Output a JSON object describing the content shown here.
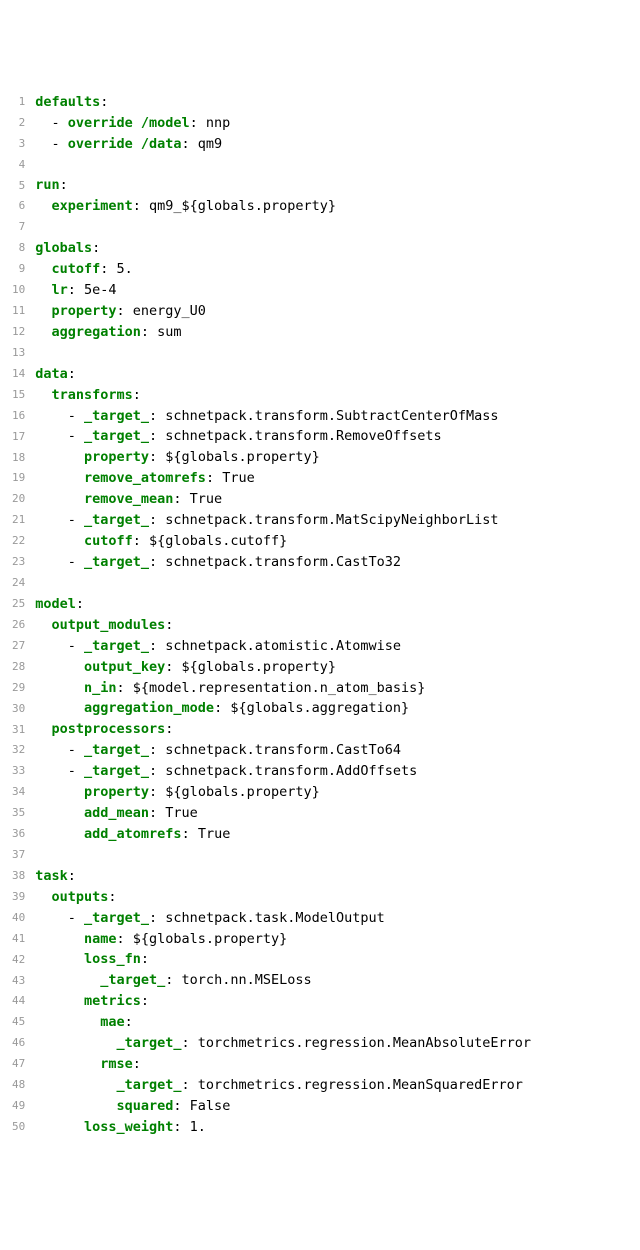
{
  "lines": [
    {
      "n": "1",
      "segs": [
        {
          "c": "k",
          "t": "defaults"
        },
        {
          "c": "t",
          "t": ":"
        }
      ]
    },
    {
      "n": "2",
      "segs": [
        {
          "c": "t",
          "t": "  - "
        },
        {
          "c": "k",
          "t": "override /model"
        },
        {
          "c": "t",
          "t": ": nnp"
        }
      ]
    },
    {
      "n": "3",
      "segs": [
        {
          "c": "t",
          "t": "  - "
        },
        {
          "c": "k",
          "t": "override /data"
        },
        {
          "c": "t",
          "t": ": qm9"
        }
      ]
    },
    {
      "n": "4",
      "segs": [
        {
          "c": "t",
          "t": ""
        }
      ]
    },
    {
      "n": "5",
      "segs": [
        {
          "c": "k",
          "t": "run"
        },
        {
          "c": "t",
          "t": ":"
        }
      ]
    },
    {
      "n": "6",
      "segs": [
        {
          "c": "t",
          "t": "  "
        },
        {
          "c": "k",
          "t": "experiment"
        },
        {
          "c": "t",
          "t": ": qm9_${globals.property}"
        }
      ]
    },
    {
      "n": "7",
      "segs": [
        {
          "c": "t",
          "t": ""
        }
      ]
    },
    {
      "n": "8",
      "segs": [
        {
          "c": "k",
          "t": "globals"
        },
        {
          "c": "t",
          "t": ":"
        }
      ]
    },
    {
      "n": "9",
      "segs": [
        {
          "c": "t",
          "t": "  "
        },
        {
          "c": "k",
          "t": "cutoff"
        },
        {
          "c": "t",
          "t": ": 5."
        }
      ]
    },
    {
      "n": "10",
      "segs": [
        {
          "c": "t",
          "t": "  "
        },
        {
          "c": "k",
          "t": "lr"
        },
        {
          "c": "t",
          "t": ": 5e-4"
        }
      ]
    },
    {
      "n": "11",
      "segs": [
        {
          "c": "t",
          "t": "  "
        },
        {
          "c": "k",
          "t": "property"
        },
        {
          "c": "t",
          "t": ": energy_U0"
        }
      ]
    },
    {
      "n": "12",
      "segs": [
        {
          "c": "t",
          "t": "  "
        },
        {
          "c": "k",
          "t": "aggregation"
        },
        {
          "c": "t",
          "t": ": sum"
        }
      ]
    },
    {
      "n": "13",
      "segs": [
        {
          "c": "t",
          "t": ""
        }
      ]
    },
    {
      "n": "14",
      "segs": [
        {
          "c": "k",
          "t": "data"
        },
        {
          "c": "t",
          "t": ":"
        }
      ]
    },
    {
      "n": "15",
      "segs": [
        {
          "c": "t",
          "t": "  "
        },
        {
          "c": "k",
          "t": "transforms"
        },
        {
          "c": "t",
          "t": ":"
        }
      ]
    },
    {
      "n": "16",
      "segs": [
        {
          "c": "t",
          "t": "    - "
        },
        {
          "c": "k",
          "t": "_target_"
        },
        {
          "c": "t",
          "t": ": schnetpack.transform.SubtractCenterOfMass"
        }
      ]
    },
    {
      "n": "17",
      "segs": [
        {
          "c": "t",
          "t": "    - "
        },
        {
          "c": "k",
          "t": "_target_"
        },
        {
          "c": "t",
          "t": ": schnetpack.transform.RemoveOffsets"
        }
      ]
    },
    {
      "n": "18",
      "segs": [
        {
          "c": "t",
          "t": "      "
        },
        {
          "c": "k",
          "t": "property"
        },
        {
          "c": "t",
          "t": ": ${globals.property}"
        }
      ]
    },
    {
      "n": "19",
      "segs": [
        {
          "c": "t",
          "t": "      "
        },
        {
          "c": "k",
          "t": "remove_atomrefs"
        },
        {
          "c": "t",
          "t": ": True"
        }
      ]
    },
    {
      "n": "20",
      "segs": [
        {
          "c": "t",
          "t": "      "
        },
        {
          "c": "k",
          "t": "remove_mean"
        },
        {
          "c": "t",
          "t": ": True"
        }
      ]
    },
    {
      "n": "21",
      "segs": [
        {
          "c": "t",
          "t": "    - "
        },
        {
          "c": "k",
          "t": "_target_"
        },
        {
          "c": "t",
          "t": ": schnetpack.transform.MatScipyNeighborList"
        }
      ]
    },
    {
      "n": "22",
      "segs": [
        {
          "c": "t",
          "t": "      "
        },
        {
          "c": "k",
          "t": "cutoff"
        },
        {
          "c": "t",
          "t": ": ${globals.cutoff}"
        }
      ]
    },
    {
      "n": "23",
      "segs": [
        {
          "c": "t",
          "t": "    - "
        },
        {
          "c": "k",
          "t": "_target_"
        },
        {
          "c": "t",
          "t": ": schnetpack.transform.CastTo32"
        }
      ]
    },
    {
      "n": "24",
      "segs": [
        {
          "c": "t",
          "t": ""
        }
      ]
    },
    {
      "n": "25",
      "segs": [
        {
          "c": "k",
          "t": "model"
        },
        {
          "c": "t",
          "t": ":"
        }
      ]
    },
    {
      "n": "26",
      "segs": [
        {
          "c": "t",
          "t": "  "
        },
        {
          "c": "k",
          "t": "output_modules"
        },
        {
          "c": "t",
          "t": ":"
        }
      ]
    },
    {
      "n": "27",
      "segs": [
        {
          "c": "t",
          "t": "    - "
        },
        {
          "c": "k",
          "t": "_target_"
        },
        {
          "c": "t",
          "t": ": schnetpack.atomistic.Atomwise"
        }
      ]
    },
    {
      "n": "28",
      "segs": [
        {
          "c": "t",
          "t": "      "
        },
        {
          "c": "k",
          "t": "output_key"
        },
        {
          "c": "t",
          "t": ": ${globals.property}"
        }
      ]
    },
    {
      "n": "29",
      "segs": [
        {
          "c": "t",
          "t": "      "
        },
        {
          "c": "k",
          "t": "n_in"
        },
        {
          "c": "t",
          "t": ": ${model.representation.n_atom_basis}"
        }
      ]
    },
    {
      "n": "30",
      "segs": [
        {
          "c": "t",
          "t": "      "
        },
        {
          "c": "k",
          "t": "aggregation_mode"
        },
        {
          "c": "t",
          "t": ": ${globals.aggregation}"
        }
      ]
    },
    {
      "n": "31",
      "segs": [
        {
          "c": "t",
          "t": "  "
        },
        {
          "c": "k",
          "t": "postprocessors"
        },
        {
          "c": "t",
          "t": ":"
        }
      ]
    },
    {
      "n": "32",
      "segs": [
        {
          "c": "t",
          "t": "    - "
        },
        {
          "c": "k",
          "t": "_target_"
        },
        {
          "c": "t",
          "t": ": schnetpack.transform.CastTo64"
        }
      ]
    },
    {
      "n": "33",
      "segs": [
        {
          "c": "t",
          "t": "    - "
        },
        {
          "c": "k",
          "t": "_target_"
        },
        {
          "c": "t",
          "t": ": schnetpack.transform.AddOffsets"
        }
      ]
    },
    {
      "n": "34",
      "segs": [
        {
          "c": "t",
          "t": "      "
        },
        {
          "c": "k",
          "t": "property"
        },
        {
          "c": "t",
          "t": ": ${globals.property}"
        }
      ]
    },
    {
      "n": "35",
      "segs": [
        {
          "c": "t",
          "t": "      "
        },
        {
          "c": "k",
          "t": "add_mean"
        },
        {
          "c": "t",
          "t": ": True"
        }
      ]
    },
    {
      "n": "36",
      "segs": [
        {
          "c": "t",
          "t": "      "
        },
        {
          "c": "k",
          "t": "add_atomrefs"
        },
        {
          "c": "t",
          "t": ": True"
        }
      ]
    },
    {
      "n": "37",
      "segs": [
        {
          "c": "t",
          "t": ""
        }
      ]
    },
    {
      "n": "38",
      "segs": [
        {
          "c": "k",
          "t": "task"
        },
        {
          "c": "t",
          "t": ":"
        }
      ]
    },
    {
      "n": "39",
      "segs": [
        {
          "c": "t",
          "t": "  "
        },
        {
          "c": "k",
          "t": "outputs"
        },
        {
          "c": "t",
          "t": ":"
        }
      ]
    },
    {
      "n": "40",
      "segs": [
        {
          "c": "t",
          "t": "    - "
        },
        {
          "c": "k",
          "t": "_target_"
        },
        {
          "c": "t",
          "t": ": schnetpack.task.ModelOutput"
        }
      ]
    },
    {
      "n": "41",
      "segs": [
        {
          "c": "t",
          "t": "      "
        },
        {
          "c": "k",
          "t": "name"
        },
        {
          "c": "t",
          "t": ": ${globals.property}"
        }
      ]
    },
    {
      "n": "42",
      "segs": [
        {
          "c": "t",
          "t": "      "
        },
        {
          "c": "k",
          "t": "loss_fn"
        },
        {
          "c": "t",
          "t": ":"
        }
      ]
    },
    {
      "n": "43",
      "segs": [
        {
          "c": "t",
          "t": "        "
        },
        {
          "c": "k",
          "t": "_target_"
        },
        {
          "c": "t",
          "t": ": torch.nn.MSELoss"
        }
      ]
    },
    {
      "n": "44",
      "segs": [
        {
          "c": "t",
          "t": "      "
        },
        {
          "c": "k",
          "t": "metrics"
        },
        {
          "c": "t",
          "t": ":"
        }
      ]
    },
    {
      "n": "45",
      "segs": [
        {
          "c": "t",
          "t": "        "
        },
        {
          "c": "k",
          "t": "mae"
        },
        {
          "c": "t",
          "t": ":"
        }
      ]
    },
    {
      "n": "46",
      "segs": [
        {
          "c": "t",
          "t": "          "
        },
        {
          "c": "k",
          "t": "_target_"
        },
        {
          "c": "t",
          "t": ": torchmetrics.regression.MeanAbsoluteError"
        }
      ]
    },
    {
      "n": "47",
      "segs": [
        {
          "c": "t",
          "t": "        "
        },
        {
          "c": "k",
          "t": "rmse"
        },
        {
          "c": "t",
          "t": ":"
        }
      ]
    },
    {
      "n": "48",
      "segs": [
        {
          "c": "t",
          "t": "          "
        },
        {
          "c": "k",
          "t": "_target_"
        },
        {
          "c": "t",
          "t": ": torchmetrics.regression.MeanSquaredError"
        }
      ]
    },
    {
      "n": "49",
      "segs": [
        {
          "c": "t",
          "t": "          "
        },
        {
          "c": "k",
          "t": "squared"
        },
        {
          "c": "t",
          "t": ": False"
        }
      ]
    },
    {
      "n": "50",
      "segs": [
        {
          "c": "t",
          "t": "      "
        },
        {
          "c": "k",
          "t": "loss_weight"
        },
        {
          "c": "t",
          "t": ": 1."
        }
      ]
    }
  ]
}
